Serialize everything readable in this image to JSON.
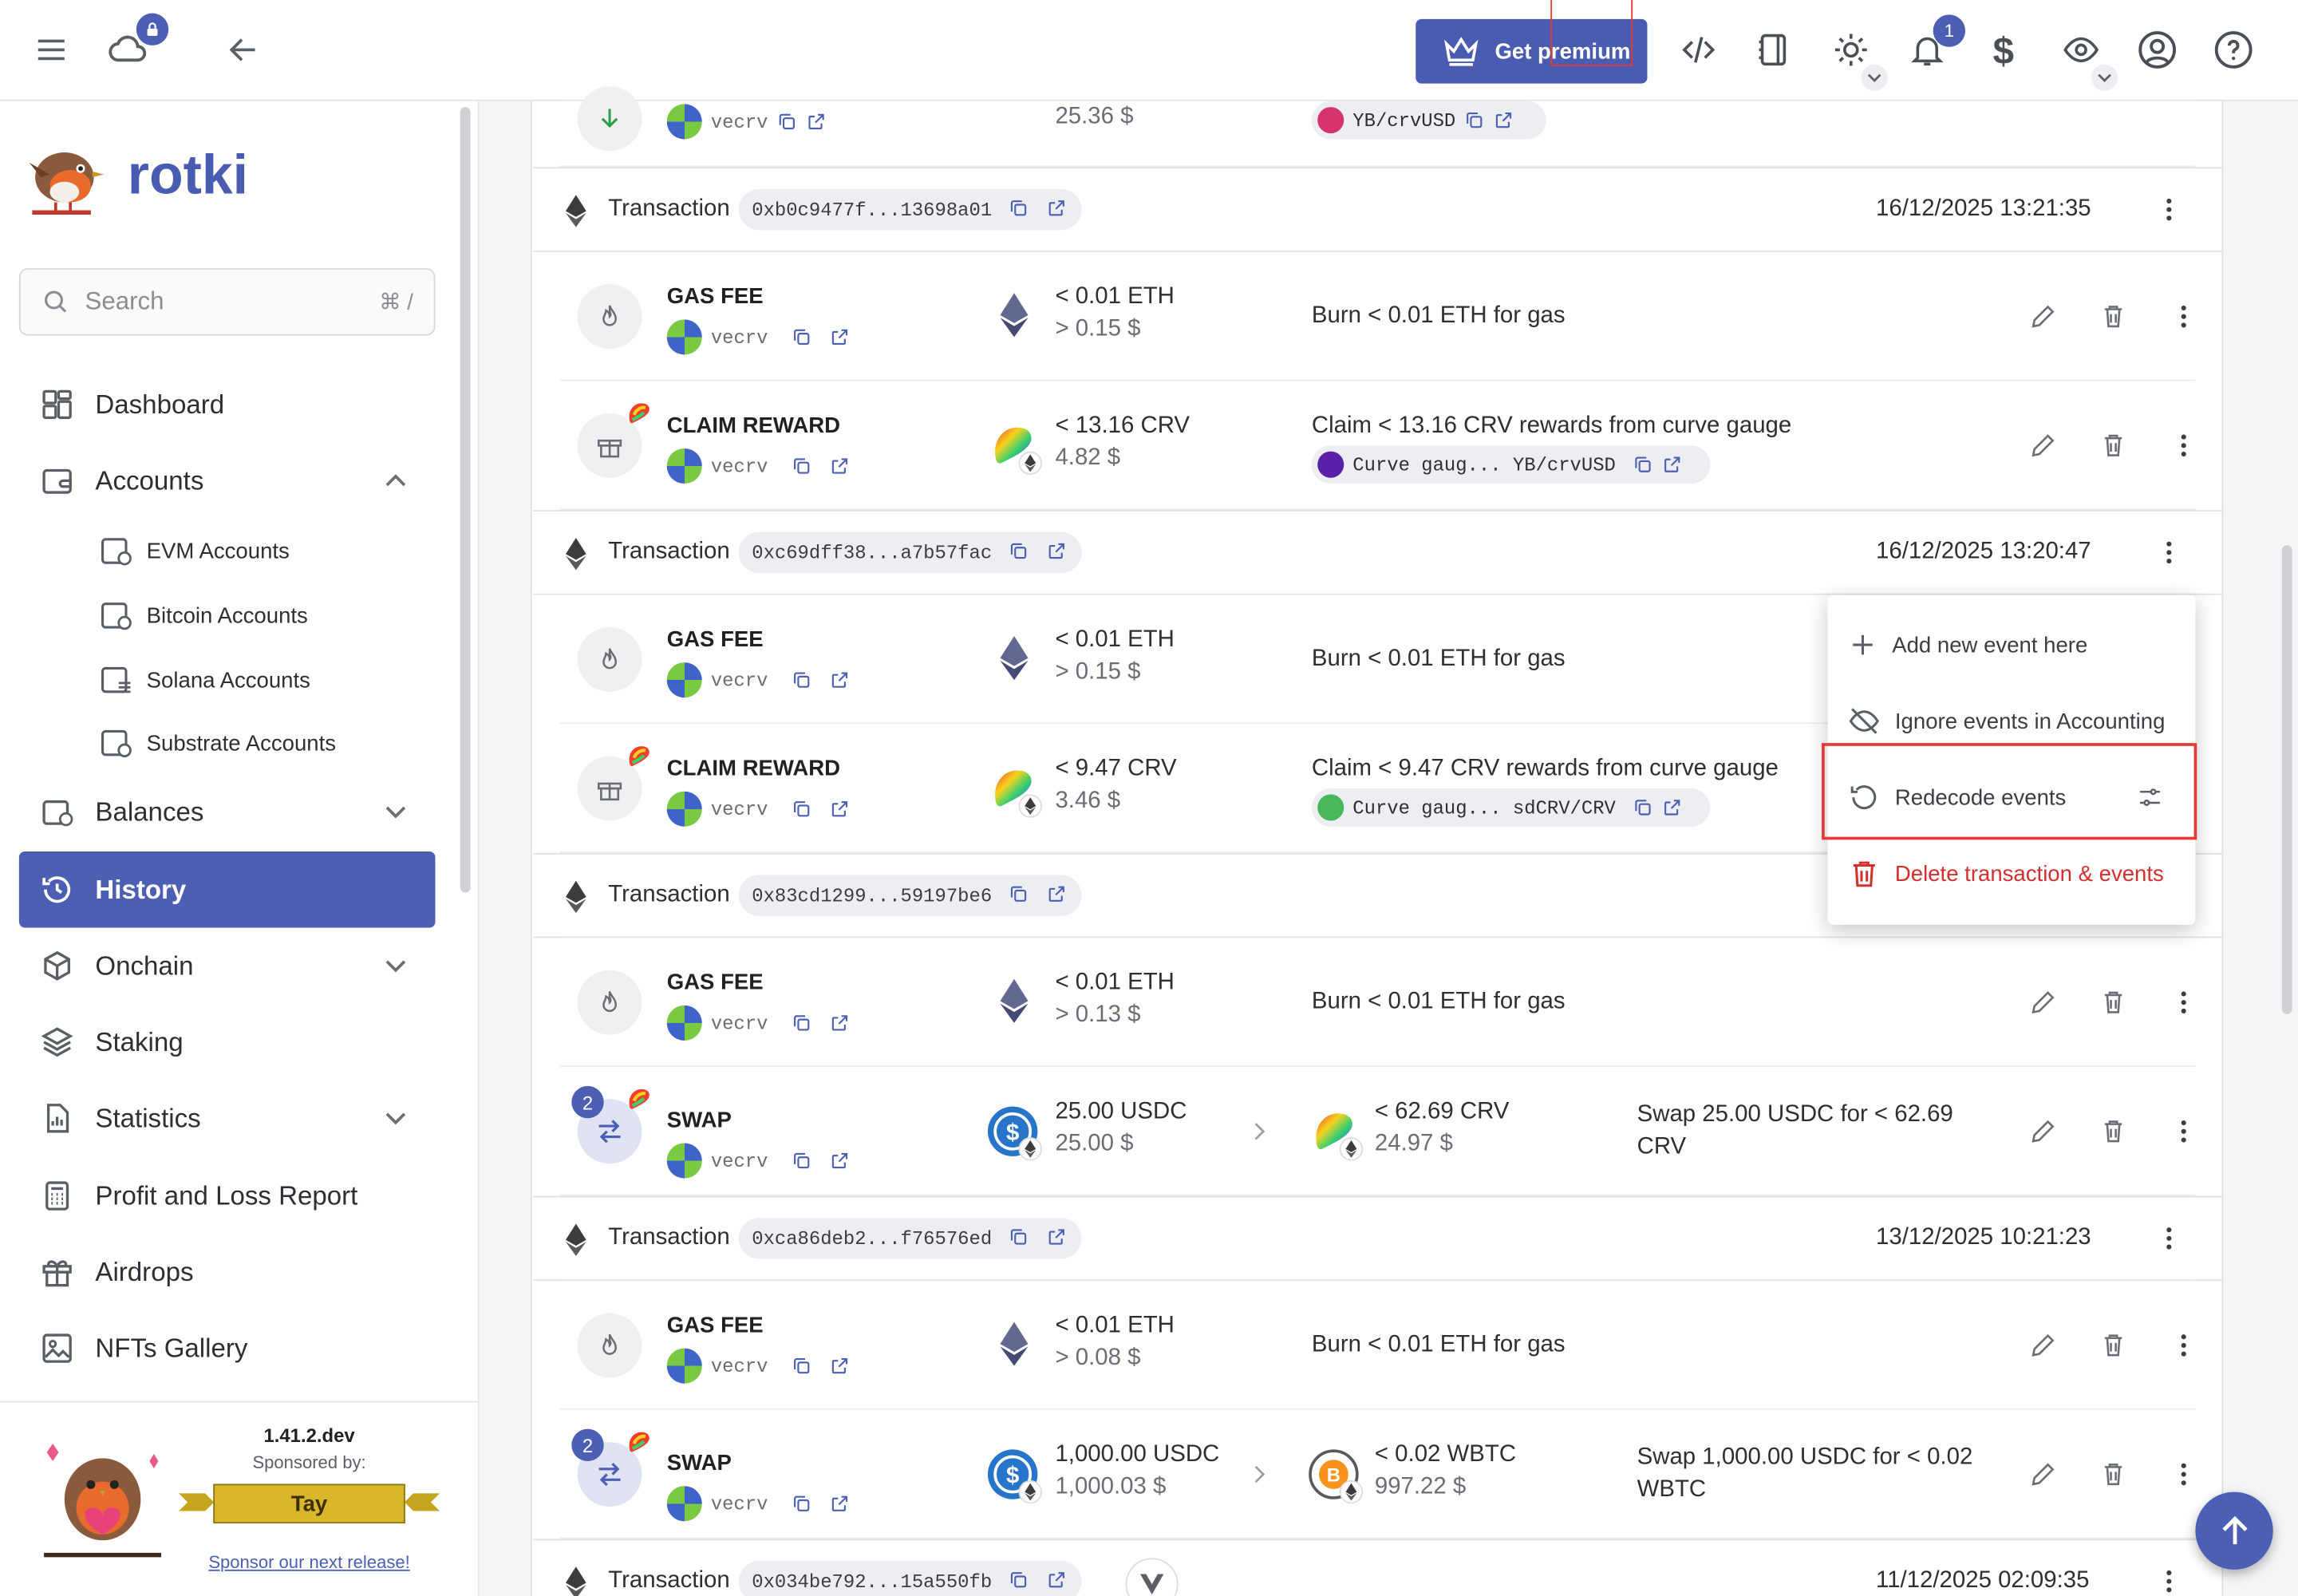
{
  "topbar": {
    "premium_label": "Get premium",
    "notification_count": "1"
  },
  "sidebar": {
    "brand": "rotki",
    "search_placeholder": "Search",
    "search_shortcut": "⌘ /",
    "items": [
      {
        "label": "Dashboard"
      },
      {
        "label": "Accounts"
      },
      {
        "label": "Balances"
      },
      {
        "label": "History"
      },
      {
        "label": "Onchain"
      },
      {
        "label": "Staking"
      },
      {
        "label": "Statistics"
      },
      {
        "label": "Profit and Loss Report"
      },
      {
        "label": "Airdrops"
      },
      {
        "label": "NFTs Gallery"
      }
    ],
    "account_sub": [
      {
        "label": "EVM Accounts"
      },
      {
        "label": "Bitcoin Accounts"
      },
      {
        "label": "Solana Accounts"
      },
      {
        "label": "Substrate Accounts"
      }
    ],
    "footer": {
      "version": "1.41.2.dev",
      "sponsored_by": "Sponsored by:",
      "sponsor_name": "Tay",
      "sponsor_link": "Sponsor our next release!"
    }
  },
  "top_partial": {
    "account": "vecrv",
    "usd": "25.36 $",
    "chip": "YB/crvUSD"
  },
  "transactions": [
    {
      "label": "Transaction",
      "hash": "0xb0c9477f...13698a01",
      "date": "16/12/2025 13:21:35",
      "events": [
        {
          "type": "GAS FEE",
          "account": "vecrv",
          "amount": "< 0.01 ETH",
          "usd": "> 0.15 $",
          "desc": "Burn < 0.01 ETH for gas"
        },
        {
          "type": "CLAIM REWARD",
          "account": "vecrv",
          "amount": "< 13.16 CRV",
          "usd": "4.82 $",
          "desc": "Claim < 13.16 CRV rewards from curve gauge",
          "chip": "Curve gaug... YB/crvUSD"
        }
      ]
    },
    {
      "label": "Transaction",
      "hash": "0xc69dff38...a7b57fac",
      "date": "16/12/2025 13:20:47",
      "events": [
        {
          "type": "GAS FEE",
          "account": "vecrv",
          "amount": "< 0.01 ETH",
          "usd": "> 0.15 $",
          "desc": "Burn < 0.01 ETH for gas"
        },
        {
          "type": "CLAIM REWARD",
          "account": "vecrv",
          "amount": "< 9.47 CRV",
          "usd": "3.46 $",
          "desc": "Claim < 9.47 CRV rewards from curve gauge",
          "chip": "Curve gaug... sdCRV/CRV"
        }
      ]
    },
    {
      "label": "Transaction",
      "hash": "0x83cd1299...59197be6",
      "date": "",
      "events": [
        {
          "type": "GAS FEE",
          "account": "vecrv",
          "amount": "< 0.01 ETH",
          "usd": "> 0.13 $",
          "desc": "Burn < 0.01 ETH for gas"
        },
        {
          "type": "SWAP",
          "count": "2",
          "account": "vecrv",
          "amount": "25.00 USDC",
          "usd": "25.00 $",
          "amount2": "< 62.69 CRV",
          "usd2": "24.97 $",
          "desc": "Swap 25.00 USDC for < 62.69 CRV"
        }
      ]
    },
    {
      "label": "Transaction",
      "hash": "0xca86deb2...f76576ed",
      "date": "13/12/2025 10:21:23",
      "events": [
        {
          "type": "GAS FEE",
          "account": "vecrv",
          "amount": "< 0.01 ETH",
          "usd": "> 0.08 $",
          "desc": "Burn < 0.01 ETH for gas"
        },
        {
          "type": "SWAP",
          "count": "2",
          "account": "vecrv",
          "amount": "1,000.00 USDC",
          "usd": "1,000.03 $",
          "amount2": "< 0.02 WBTC",
          "usd2": "997.22 $",
          "desc": "Swap 1,000.00 USDC for < 0.02 WBTC"
        }
      ]
    },
    {
      "label": "Transaction",
      "hash": "0x034be792...15a550fb",
      "date": "11/12/2025 02:09:35",
      "events": []
    }
  ],
  "context_menu": {
    "items": [
      {
        "label": "Add new event here"
      },
      {
        "label": "Ignore events in Accounting"
      },
      {
        "label": "Redecode events"
      },
      {
        "label": "Delete transaction & events"
      }
    ]
  },
  "colors": {
    "accent": "#4c5fb4",
    "danger": "#d32f2f"
  }
}
